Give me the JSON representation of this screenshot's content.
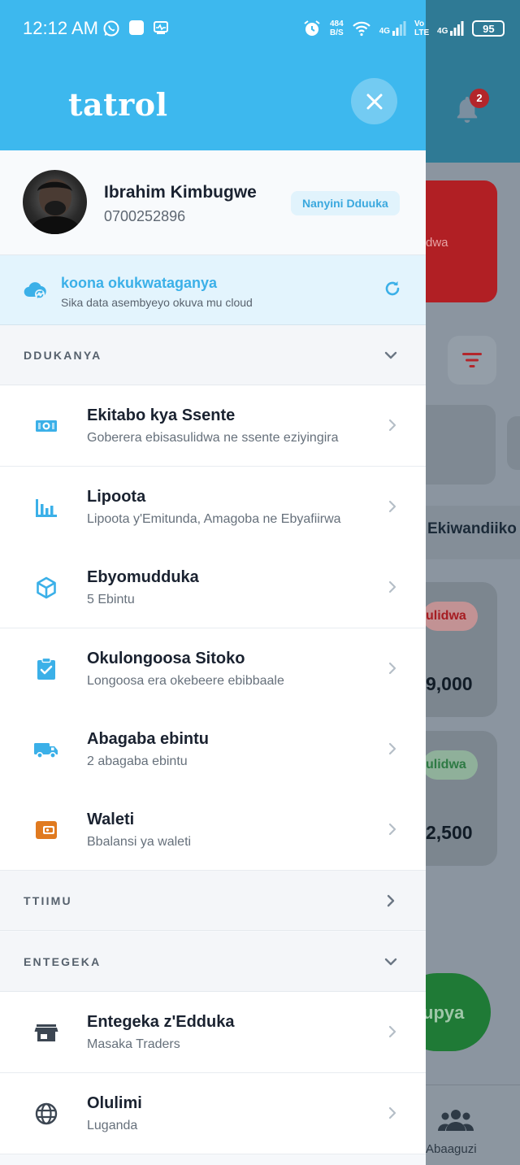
{
  "status_bar": {
    "time": "12:12 AM",
    "net_speed_value": "484",
    "net_speed_unit": "B/S",
    "network_1": "4G",
    "volte": "Vo LTE",
    "network_2": "4G",
    "battery": "95"
  },
  "drawer": {
    "brand": "tatrol",
    "profile": {
      "name": "Ibrahim Kimbugwe",
      "phone": "0700252896",
      "role": "Nanyini Dduuka"
    },
    "sync": {
      "title": "koona okukwataganya",
      "subtitle": "Sika data asembyeyo okuva mu cloud"
    },
    "sections": {
      "shop": "DDUKANYA",
      "team": "TTIIMU",
      "settings": "ENTEGEKA"
    },
    "shop_items": [
      {
        "title": "Ekitabo kya Ssente",
        "subtitle": "Goberera ebisasulidwa ne ssente eziyingira",
        "icon": "money-icon"
      },
      {
        "title": "Lipoota",
        "subtitle": "Lipoota y'Emitunda, Amagoba ne Ebyafiirwa",
        "icon": "bar-chart-icon"
      },
      {
        "title": "Ebyomudduka",
        "subtitle": "5 Ebintu",
        "icon": "box-icon"
      },
      {
        "title": "Okulongoosa Sitoko",
        "subtitle": "Longoosa era okebeere ebibbaale",
        "icon": "clipboard-check-icon"
      },
      {
        "title": "Abagaba ebintu",
        "subtitle": "2 abagaba ebintu",
        "icon": "truck-icon"
      },
      {
        "title": "Waleti",
        "subtitle": "Bbalansi ya waleti",
        "icon": "wallet-icon"
      }
    ],
    "settings_items": [
      {
        "title": "Entegeka z'Edduka",
        "subtitle": "Masaka Traders",
        "icon": "store-icon"
      },
      {
        "title": "Olulimi",
        "subtitle": "Luganda",
        "icon": "globe-icon"
      }
    ]
  },
  "background": {
    "notification_count": "2",
    "red_card_text": "dwa",
    "tab_label": "Ekiwandiiko",
    "card_1_pill": "ulidwa",
    "card_1_amount": "9,000",
    "card_2_pill": "ulidwa",
    "card_2_amount": "2,500",
    "fab_label": "upya",
    "nav_label": "Abaaguzi"
  },
  "colors": {
    "accent": "#3db8ee",
    "danger": "#b11f24",
    "success": "#1f7a36",
    "wallet": "#e07a1f"
  }
}
